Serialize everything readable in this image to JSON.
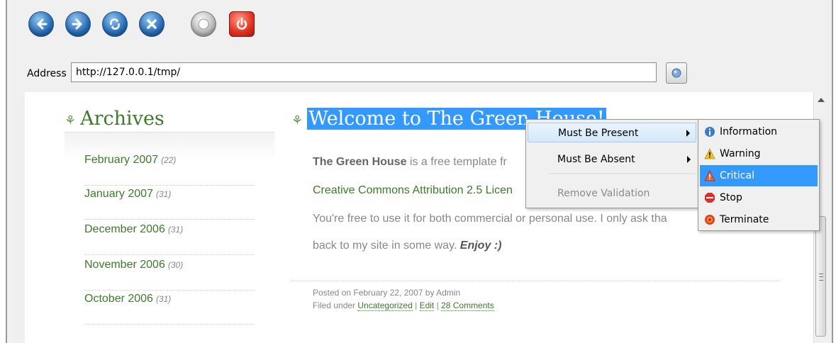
{
  "toolbar": {
    "back_icon": "back-arrow-icon",
    "forward_icon": "forward-arrow-icon",
    "refresh_icon": "refresh-icon",
    "stop_icon": "stop-x-icon",
    "record_icon": "record-icon",
    "power_icon": "power-icon"
  },
  "address": {
    "label": "Address",
    "value": "http://127.0.0.1/tmp/"
  },
  "archives": {
    "title": "Archives",
    "items": [
      {
        "label": "February 2007",
        "count": "(22)"
      },
      {
        "label": "January 2007",
        "count": "(31)"
      },
      {
        "label": "December 2006",
        "count": "(31)"
      },
      {
        "label": "November 2006",
        "count": "(30)"
      },
      {
        "label": "October 2006",
        "count": "(31)"
      }
    ]
  },
  "post": {
    "title_selected": "Welcome to The Green House!",
    "intro_bold": "The Green House",
    "intro_rest": " is a free template fr",
    "license_link": "Creative Commons Attribution 2.5 Licen",
    "usage_line": "You're free to use it for both commercial or personal use. I only ask tha",
    "back_line": "back to my site in some way. ",
    "enjoy": "Enjoy :)",
    "posted": "Posted on February 22, 2007 by Admin",
    "filed_prefix": "Filed under ",
    "category": "Uncategorized",
    "sep1": " | ",
    "edit": "Edit",
    "sep2": " | ",
    "comments": "28 Comments"
  },
  "context_menu": {
    "items": [
      {
        "label": "Must Be Present",
        "submenu": true,
        "active": true
      },
      {
        "label": "Must Be Absent",
        "submenu": true
      },
      {
        "label": "Remove Validation",
        "disabled": true
      }
    ]
  },
  "submenu": {
    "items": [
      {
        "label": "Information",
        "icon": "info-icon"
      },
      {
        "label": "Warning",
        "icon": "warning-icon"
      },
      {
        "label": "Critical",
        "icon": "critical-icon",
        "selected": true
      },
      {
        "label": "Stop",
        "icon": "stop-sign-icon"
      },
      {
        "label": "Terminate",
        "icon": "terminate-icon"
      }
    ]
  },
  "colors": {
    "link_green": "#3d7a2a",
    "selection_blue": "#3399ff"
  }
}
